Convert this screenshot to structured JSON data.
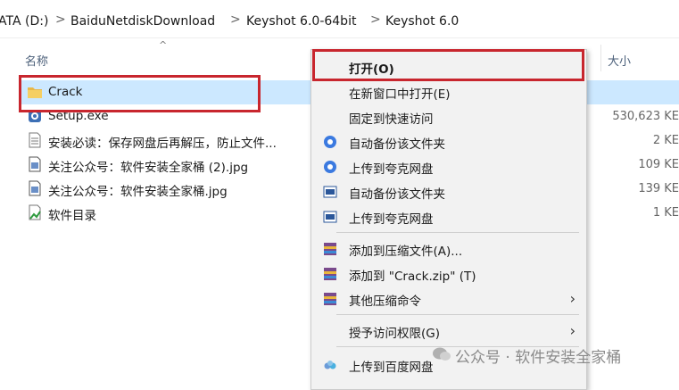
{
  "breadcrumb": {
    "items": [
      "ATA (D:)",
      "BaiduNetdiskDownload",
      "Keyshot 6.0-64bit",
      "Keyshot 6.0"
    ],
    "separator": ">"
  },
  "columns": {
    "name": "名称",
    "size": "大小"
  },
  "files": [
    {
      "name": "Crack",
      "size": "",
      "icon": "folder-icon"
    },
    {
      "name": "Setup.exe",
      "size": "530,623 KE",
      "icon": "setup-exe-icon"
    },
    {
      "name": "安装必读：保存网盘后再解压，防止文件...",
      "size": "2 KE",
      "icon": "text-file-icon"
    },
    {
      "name": "关注公众号：软件安装全家桶 (2).jpg",
      "size": "109 KE",
      "icon": "image-file-icon"
    },
    {
      "name": "关注公众号：软件安装全家桶.jpg",
      "size": "139 KE",
      "icon": "image-file-icon"
    },
    {
      "name": "软件目录",
      "size": "1 KE",
      "icon": "shortcut-file-icon"
    }
  ],
  "context_menu": {
    "items": [
      {
        "label": "打开(O)",
        "bold": true,
        "icon": ""
      },
      {
        "label": "在新窗口中打开(E)",
        "icon": ""
      },
      {
        "label": "固定到快速访问",
        "icon": ""
      },
      {
        "label": "自动备份该文件夹",
        "icon": "quark-cloud-icon"
      },
      {
        "label": "上传到夸克网盘",
        "icon": "quark-cloud-icon"
      },
      {
        "label": "自动备份该文件夹",
        "icon": "backup-window-icon"
      },
      {
        "label": "上传到夸克网盘",
        "icon": "backup-window-icon"
      },
      {
        "label": "添加到压缩文件(A)...",
        "icon": "winrar-icon"
      },
      {
        "label": "添加到 \"Crack.zip\" (T)",
        "icon": "winrar-icon"
      },
      {
        "label": "其他压缩命令",
        "icon": "winrar-icon",
        "submenu": true
      },
      {
        "label": "授予访问权限(G)",
        "icon": "",
        "submenu": true
      },
      {
        "label": "上传到百度网盘",
        "icon": "baidu-cloud-icon"
      }
    ]
  },
  "watermark": "公众号 · 软件安装全家桶",
  "colors": {
    "selection": "#cce8ff",
    "highlight_box": "#c8262e",
    "menu_bg": "#f2f2f2"
  }
}
